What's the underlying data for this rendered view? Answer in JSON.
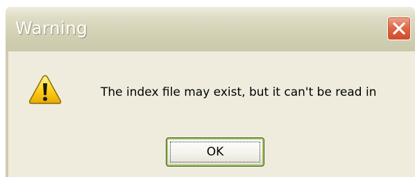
{
  "window": {
    "title": "Warning"
  },
  "icons": {
    "close": "close-icon",
    "warning": "warning-icon"
  },
  "dialog": {
    "message": "The index file may exist, but it can't be read in",
    "ok_label": "OK"
  },
  "colors": {
    "title_text": "#ffffff",
    "close_button": "#de6a48",
    "client_background": "#efecde",
    "warning_yellow": "#ffd21f",
    "ok_focus_border": "#a6c46c"
  }
}
